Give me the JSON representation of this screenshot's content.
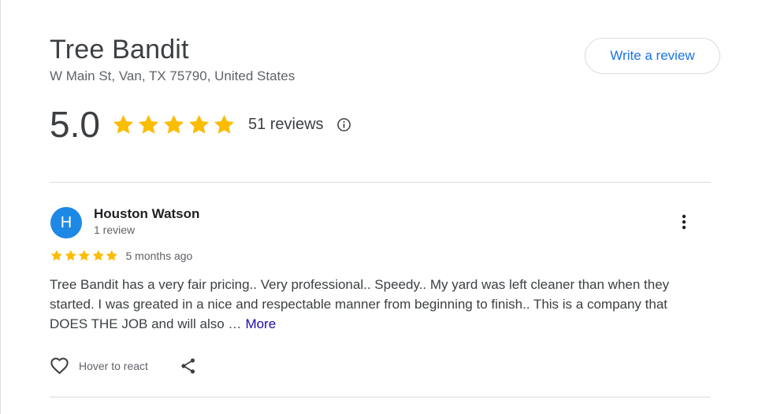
{
  "business": {
    "name": "Tree Bandit",
    "address": "W Main St, Van, TX 75790, United States"
  },
  "header": {
    "write_review_label": "Write a review"
  },
  "summary": {
    "rating": "5.0",
    "stars_filled": 5,
    "stars_total": 5,
    "review_count_label": "51 reviews",
    "info_icon": "info-circle-icon"
  },
  "review": {
    "avatar_letter": "H",
    "author": "Houston Watson",
    "author_meta": "1 review",
    "stars_filled": 5,
    "date": "5 months ago",
    "text": "Tree Bandit has a very fair pricing.. Very professional.. Speedy.. My yard was left cleaner than when they started. I was greated in a nice and respectable manner from beginning to finish.. This is a company that DOES THE JOB and will also …",
    "more_label": "More",
    "react_label": "Hover to react",
    "menu_icon": "more-vert-icon",
    "heart_icon": "heart-outline-icon",
    "share_icon": "share-icon"
  },
  "colors": {
    "star": "#fbbc04",
    "accent": "#1a73e8",
    "more_link": "#1a0dab",
    "avatar": "#1e88e5",
    "divider": "#dadce0"
  }
}
